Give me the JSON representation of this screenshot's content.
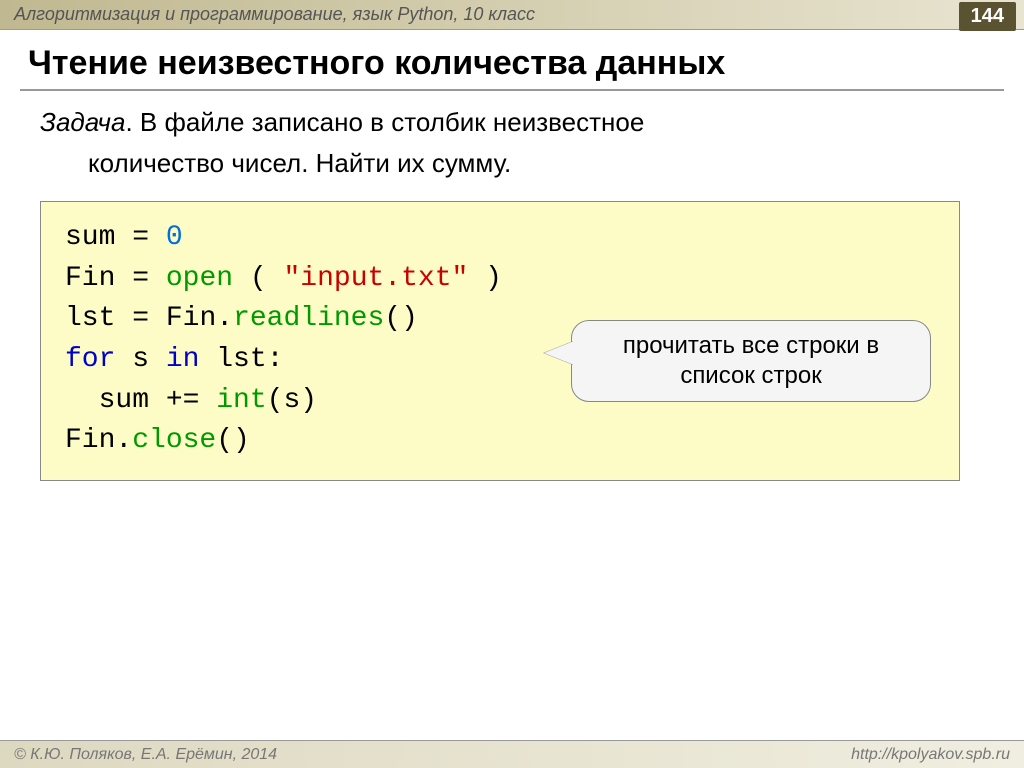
{
  "header": {
    "subject": "Алгоритмизация и программирование, язык Python, 10 класс",
    "page": "144"
  },
  "title": "Чтение неизвестного количества данных",
  "task": {
    "label": "Задача",
    "line1": ". В файле записано в столбик неизвестное",
    "line2": "количество чисел. Найти их сумму."
  },
  "code": {
    "l1a": "sum",
    "l1b": " = ",
    "l1c": "0",
    "l2a": "Fin",
    "l2b": " = ",
    "l2c": "open",
    "l2d": " ( ",
    "l2e": "\"input.txt\"",
    "l2f": " )",
    "l3a": "lst",
    "l3b": " = ",
    "l3c": "Fin.",
    "l3d": "readlines",
    "l3e": "()",
    "l4a": "for",
    "l4b": " s ",
    "l4c": "in",
    "l4d": " lst:",
    "l5a": "  sum",
    "l5b": " += ",
    "l5c": "int",
    "l5d": "(s)",
    "l6a": "Fin.",
    "l6b": "close",
    "l6c": "()"
  },
  "callout": "прочитать все строки в список строк",
  "footer": {
    "left": "© К.Ю. Поляков, Е.А. Ерёмин, 2014",
    "right": "http://kpolyakov.spb.ru"
  }
}
